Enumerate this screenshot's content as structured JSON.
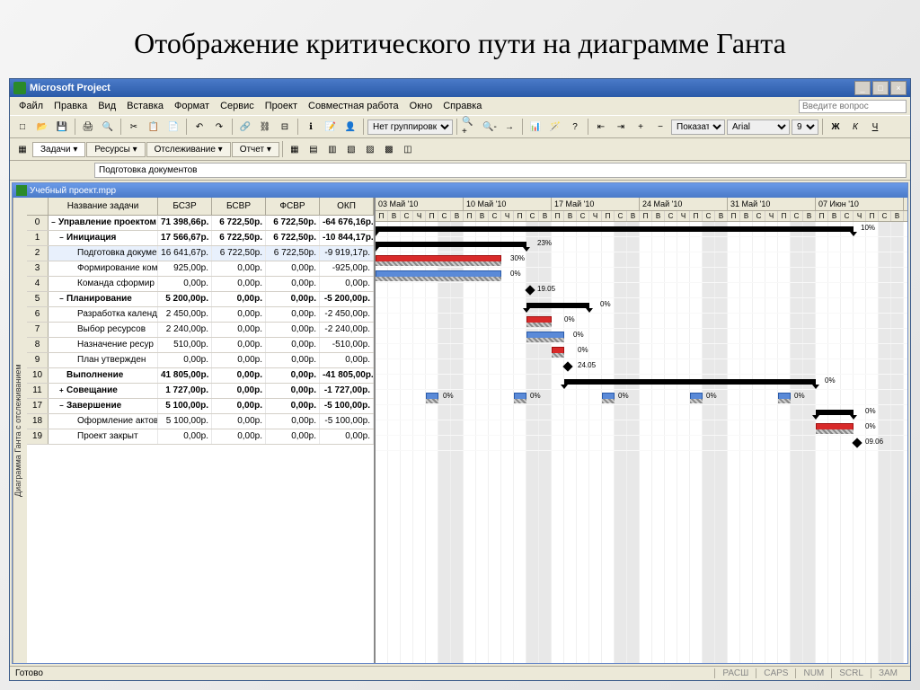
{
  "slide": {
    "title": "Отображение критического пути на диаграмме Ганта"
  },
  "app": {
    "title": "Microsoft Project"
  },
  "menu": {
    "file": "Файл",
    "edit": "Правка",
    "view": "Вид",
    "insert": "Вставка",
    "format": "Формат",
    "tools": "Сервис",
    "project": "Проект",
    "collab": "Совместная работа",
    "window": "Окно",
    "help": "Справка",
    "help_placeholder": "Введите вопрос"
  },
  "toolbar": {
    "grouping": "Нет группировки",
    "show": "Показать",
    "font": "Arial",
    "size": "9"
  },
  "tabs": {
    "tasks": "Задачи",
    "resources": "Ресурсы",
    "tracking": "Отслеживание",
    "report": "Отчет"
  },
  "formula": {
    "value": "Подготовка документов"
  },
  "doc": {
    "title": "Учебный проект.mpp"
  },
  "side_label": "Диаграмма Ганта с отслеживанием",
  "columns": {
    "name": "Название задачи",
    "c1": "БСЗР",
    "c2": "БСВР",
    "c3": "ФСВР",
    "c4": "ОКП"
  },
  "weeks": [
    "03 Май '10",
    "10 Май '10",
    "17 Май '10",
    "24 Май '10",
    "31 Май '10",
    "07 Июн '10"
  ],
  "days_pattern": [
    "П",
    "В",
    "С",
    "Ч",
    "П",
    "С",
    "В"
  ],
  "rows": [
    {
      "n": "0",
      "name": "Управление проектом",
      "c1": "71 398,66р.",
      "c2": "6 722,50р.",
      "c3": "6 722,50р.",
      "c4": "-64 676,16р.",
      "bold": true,
      "outline": "−",
      "indent": 0
    },
    {
      "n": "1",
      "name": "Инициация",
      "c1": "17 566,67р.",
      "c2": "6 722,50р.",
      "c3": "6 722,50р.",
      "c4": "-10 844,17р.",
      "bold": true,
      "outline": "−",
      "indent": 1
    },
    {
      "n": "2",
      "name": "Подготовка докуме",
      "c1": "16 641,67р.",
      "c2": "6 722,50р.",
      "c3": "6 722,50р.",
      "c4": "-9 919,17р.",
      "indent": 2,
      "sel": true
    },
    {
      "n": "3",
      "name": "Формирование ком",
      "c1": "925,00р.",
      "c2": "0,00р.",
      "c3": "0,00р.",
      "c4": "-925,00р.",
      "indent": 2
    },
    {
      "n": "4",
      "name": "Команда сформир",
      "c1": "0,00р.",
      "c2": "0,00р.",
      "c3": "0,00р.",
      "c4": "0,00р.",
      "indent": 2
    },
    {
      "n": "5",
      "name": "Планирование",
      "c1": "5 200,00р.",
      "c2": "0,00р.",
      "c3": "0,00р.",
      "c4": "-5 200,00р.",
      "bold": true,
      "outline": "−",
      "indent": 1
    },
    {
      "n": "6",
      "name": "Разработка календ",
      "c1": "2 450,00р.",
      "c2": "0,00р.",
      "c3": "0,00р.",
      "c4": "-2 450,00р.",
      "indent": 2
    },
    {
      "n": "7",
      "name": "Выбор ресурсов",
      "c1": "2 240,00р.",
      "c2": "0,00р.",
      "c3": "0,00р.",
      "c4": "-2 240,00р.",
      "indent": 2
    },
    {
      "n": "8",
      "name": "Назначение ресур",
      "c1": "510,00р.",
      "c2": "0,00р.",
      "c3": "0,00р.",
      "c4": "-510,00р.",
      "indent": 2
    },
    {
      "n": "9",
      "name": "План утвержден",
      "c1": "0,00р.",
      "c2": "0,00р.",
      "c3": "0,00р.",
      "c4": "0,00р.",
      "indent": 2
    },
    {
      "n": "10",
      "name": "Выполнение",
      "c1": "41 805,00р.",
      "c2": "0,00р.",
      "c3": "0,00р.",
      "c4": "-41 805,00р.",
      "bold": true,
      "outline": "",
      "indent": 1
    },
    {
      "n": "11",
      "name": "Совещание",
      "c1": "1 727,00р.",
      "c2": "0,00р.",
      "c3": "0,00р.",
      "c4": "-1 727,00р.",
      "bold": true,
      "outline": "+",
      "indent": 1
    },
    {
      "n": "17",
      "name": "Завершение",
      "c1": "5 100,00р.",
      "c2": "0,00р.",
      "c3": "0,00р.",
      "c4": "-5 100,00р.",
      "bold": true,
      "outline": "−",
      "indent": 1
    },
    {
      "n": "18",
      "name": "Оформление актов",
      "c1": "5 100,00р.",
      "c2": "0,00р.",
      "c3": "0,00р.",
      "c4": "-5 100,00р.",
      "indent": 2
    },
    {
      "n": "19",
      "name": "Проект закрыт",
      "c1": "0,00р.",
      "c2": "0,00р.",
      "c3": "0,00р.",
      "c4": "0,00р.",
      "indent": 2
    }
  ],
  "gantt_labels": {
    "pct10": "10%",
    "pct23": "23%",
    "pct30": "30%",
    "pct0": "0%",
    "ms1": "19.05",
    "ms2": "24.05",
    "ms3": "09.06"
  },
  "statusbar": {
    "ready": "Готово",
    "ind1": "РАСШ",
    "ind2": "CAPS",
    "ind3": "NUM",
    "ind4": "SCRL",
    "ind5": "ЗАМ"
  }
}
